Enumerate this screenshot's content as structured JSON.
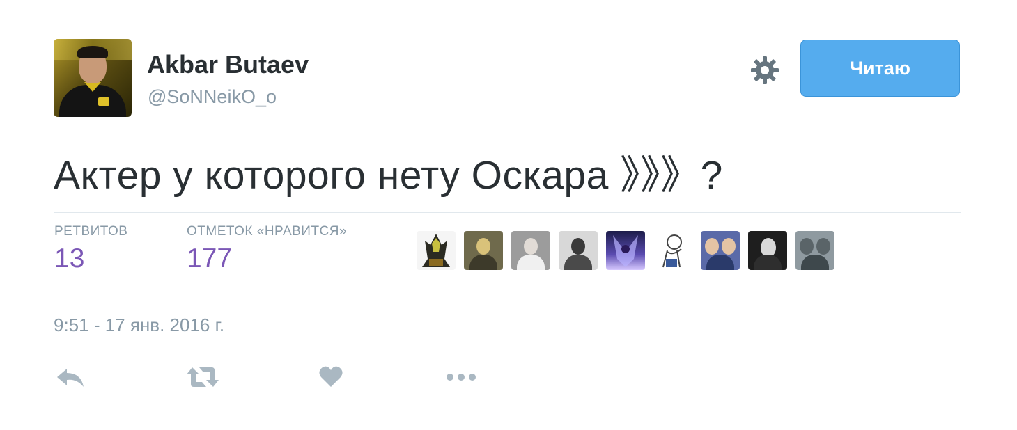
{
  "user": {
    "display_name": "Akbar Butaev",
    "screen_name": "@SoNNeikO_o",
    "avatar": "profile-photo"
  },
  "header": {
    "settings_icon": "gear-icon",
    "follow_label": "Читаю"
  },
  "tweet": {
    "text": "Актер у которого нету Оскара 》》》?",
    "timestamp": "9:51 - 17 янв. 2016 г."
  },
  "stats": {
    "retweets_label": "РЕТВИТОВ",
    "retweets_count": "13",
    "likes_label": "ОТМЕТОК «НРАВИТСЯ»",
    "likes_count": "177"
  },
  "likers": [
    {
      "icon": "liker-avatar-1"
    },
    {
      "icon": "liker-avatar-2"
    },
    {
      "icon": "liker-avatar-3"
    },
    {
      "icon": "liker-avatar-4"
    },
    {
      "icon": "liker-avatar-5"
    },
    {
      "icon": "liker-avatar-6"
    },
    {
      "icon": "liker-avatar-7"
    },
    {
      "icon": "liker-avatar-8"
    },
    {
      "icon": "liker-avatar-9"
    }
  ],
  "actions": [
    {
      "icon": "reply-icon"
    },
    {
      "icon": "retweet-icon"
    },
    {
      "icon": "heart-icon"
    },
    {
      "icon": "more-icon"
    }
  ],
  "colors": {
    "accent": "#55acee",
    "count": "#7b57b6",
    "muted": "#8899a6",
    "text": "#292f33",
    "action_icon": "#aab8c2"
  }
}
